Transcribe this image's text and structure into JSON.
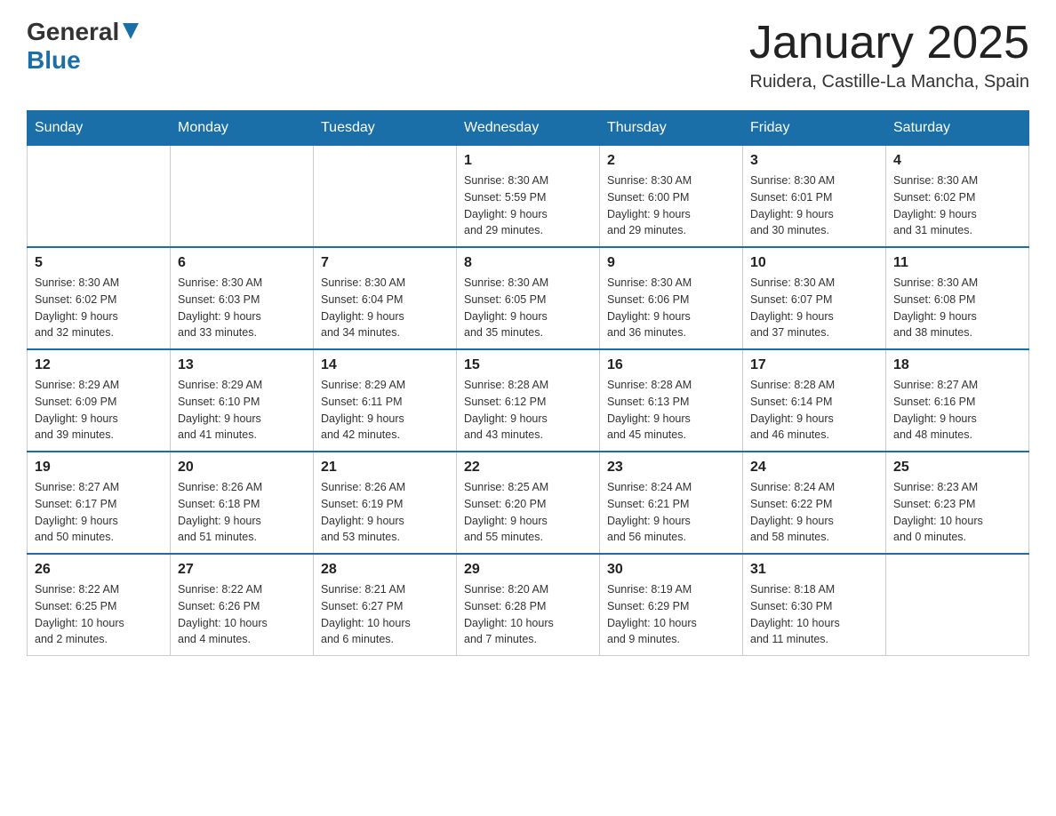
{
  "header": {
    "logo_general": "General",
    "logo_blue": "Blue",
    "title": "January 2025",
    "subtitle": "Ruidera, Castille-La Mancha, Spain"
  },
  "columns": [
    "Sunday",
    "Monday",
    "Tuesday",
    "Wednesday",
    "Thursday",
    "Friday",
    "Saturday"
  ],
  "weeks": [
    [
      {
        "day": "",
        "info": ""
      },
      {
        "day": "",
        "info": ""
      },
      {
        "day": "",
        "info": ""
      },
      {
        "day": "1",
        "info": "Sunrise: 8:30 AM\nSunset: 5:59 PM\nDaylight: 9 hours\nand 29 minutes."
      },
      {
        "day": "2",
        "info": "Sunrise: 8:30 AM\nSunset: 6:00 PM\nDaylight: 9 hours\nand 29 minutes."
      },
      {
        "day": "3",
        "info": "Sunrise: 8:30 AM\nSunset: 6:01 PM\nDaylight: 9 hours\nand 30 minutes."
      },
      {
        "day": "4",
        "info": "Sunrise: 8:30 AM\nSunset: 6:02 PM\nDaylight: 9 hours\nand 31 minutes."
      }
    ],
    [
      {
        "day": "5",
        "info": "Sunrise: 8:30 AM\nSunset: 6:02 PM\nDaylight: 9 hours\nand 32 minutes."
      },
      {
        "day": "6",
        "info": "Sunrise: 8:30 AM\nSunset: 6:03 PM\nDaylight: 9 hours\nand 33 minutes."
      },
      {
        "day": "7",
        "info": "Sunrise: 8:30 AM\nSunset: 6:04 PM\nDaylight: 9 hours\nand 34 minutes."
      },
      {
        "day": "8",
        "info": "Sunrise: 8:30 AM\nSunset: 6:05 PM\nDaylight: 9 hours\nand 35 minutes."
      },
      {
        "day": "9",
        "info": "Sunrise: 8:30 AM\nSunset: 6:06 PM\nDaylight: 9 hours\nand 36 minutes."
      },
      {
        "day": "10",
        "info": "Sunrise: 8:30 AM\nSunset: 6:07 PM\nDaylight: 9 hours\nand 37 minutes."
      },
      {
        "day": "11",
        "info": "Sunrise: 8:30 AM\nSunset: 6:08 PM\nDaylight: 9 hours\nand 38 minutes."
      }
    ],
    [
      {
        "day": "12",
        "info": "Sunrise: 8:29 AM\nSunset: 6:09 PM\nDaylight: 9 hours\nand 39 minutes."
      },
      {
        "day": "13",
        "info": "Sunrise: 8:29 AM\nSunset: 6:10 PM\nDaylight: 9 hours\nand 41 minutes."
      },
      {
        "day": "14",
        "info": "Sunrise: 8:29 AM\nSunset: 6:11 PM\nDaylight: 9 hours\nand 42 minutes."
      },
      {
        "day": "15",
        "info": "Sunrise: 8:28 AM\nSunset: 6:12 PM\nDaylight: 9 hours\nand 43 minutes."
      },
      {
        "day": "16",
        "info": "Sunrise: 8:28 AM\nSunset: 6:13 PM\nDaylight: 9 hours\nand 45 minutes."
      },
      {
        "day": "17",
        "info": "Sunrise: 8:28 AM\nSunset: 6:14 PM\nDaylight: 9 hours\nand 46 minutes."
      },
      {
        "day": "18",
        "info": "Sunrise: 8:27 AM\nSunset: 6:16 PM\nDaylight: 9 hours\nand 48 minutes."
      }
    ],
    [
      {
        "day": "19",
        "info": "Sunrise: 8:27 AM\nSunset: 6:17 PM\nDaylight: 9 hours\nand 50 minutes."
      },
      {
        "day": "20",
        "info": "Sunrise: 8:26 AM\nSunset: 6:18 PM\nDaylight: 9 hours\nand 51 minutes."
      },
      {
        "day": "21",
        "info": "Sunrise: 8:26 AM\nSunset: 6:19 PM\nDaylight: 9 hours\nand 53 minutes."
      },
      {
        "day": "22",
        "info": "Sunrise: 8:25 AM\nSunset: 6:20 PM\nDaylight: 9 hours\nand 55 minutes."
      },
      {
        "day": "23",
        "info": "Sunrise: 8:24 AM\nSunset: 6:21 PM\nDaylight: 9 hours\nand 56 minutes."
      },
      {
        "day": "24",
        "info": "Sunrise: 8:24 AM\nSunset: 6:22 PM\nDaylight: 9 hours\nand 58 minutes."
      },
      {
        "day": "25",
        "info": "Sunrise: 8:23 AM\nSunset: 6:23 PM\nDaylight: 10 hours\nand 0 minutes."
      }
    ],
    [
      {
        "day": "26",
        "info": "Sunrise: 8:22 AM\nSunset: 6:25 PM\nDaylight: 10 hours\nand 2 minutes."
      },
      {
        "day": "27",
        "info": "Sunrise: 8:22 AM\nSunset: 6:26 PM\nDaylight: 10 hours\nand 4 minutes."
      },
      {
        "day": "28",
        "info": "Sunrise: 8:21 AM\nSunset: 6:27 PM\nDaylight: 10 hours\nand 6 minutes."
      },
      {
        "day": "29",
        "info": "Sunrise: 8:20 AM\nSunset: 6:28 PM\nDaylight: 10 hours\nand 7 minutes."
      },
      {
        "day": "30",
        "info": "Sunrise: 8:19 AM\nSunset: 6:29 PM\nDaylight: 10 hours\nand 9 minutes."
      },
      {
        "day": "31",
        "info": "Sunrise: 8:18 AM\nSunset: 6:30 PM\nDaylight: 10 hours\nand 11 minutes."
      },
      {
        "day": "",
        "info": ""
      }
    ]
  ]
}
